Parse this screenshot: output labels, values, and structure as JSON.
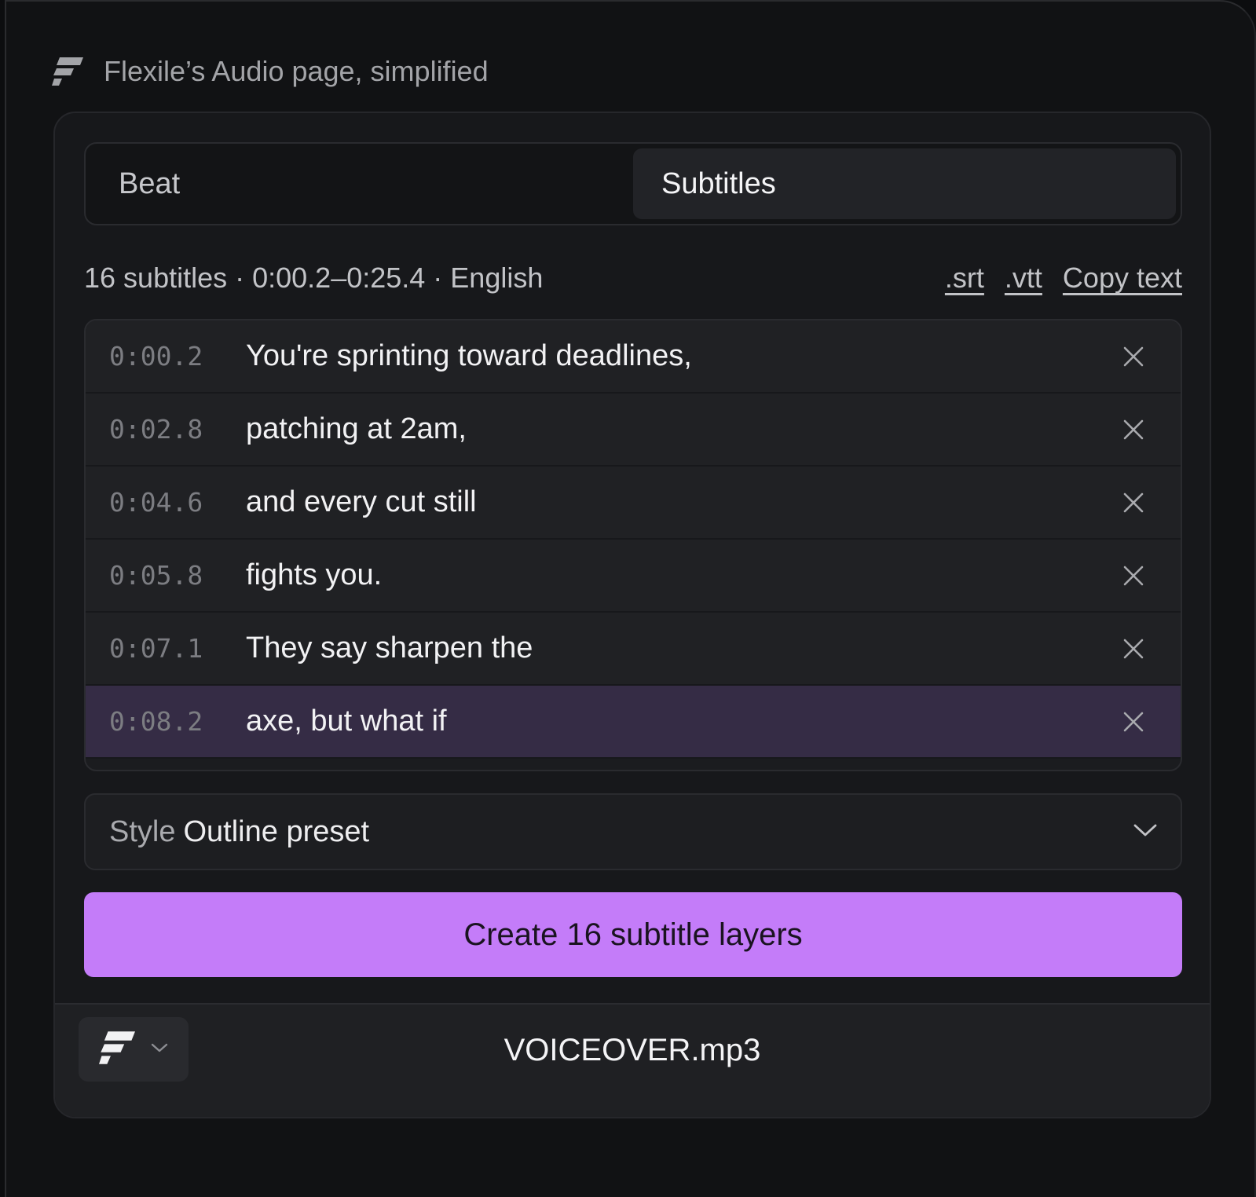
{
  "caption": {
    "title": "Flexile’s Audio page, simplified",
    "logo_icon": "flexile-logo-icon"
  },
  "tabs": [
    {
      "label": "Beat",
      "active": false
    },
    {
      "label": "Subtitles",
      "active": true
    }
  ],
  "summary": {
    "text": "16 subtitles · 0:00.2–0:25.4 · English",
    "links": [
      ".srt",
      ".vtt",
      "Copy text"
    ]
  },
  "subtitles": [
    {
      "time": "0:00.2",
      "text": "You're sprinting toward deadlines,"
    },
    {
      "time": "0:02.8",
      "text": "patching at 2am,"
    },
    {
      "time": "0:04.6",
      "text": "and every cut still"
    },
    {
      "time": "0:05.8",
      "text": "fights you."
    },
    {
      "time": "0:07.1",
      "text": "They say sharpen the"
    },
    {
      "time": "0:08.2",
      "text": "axe, but what if",
      "selected": true
    }
  ],
  "style": {
    "label": "Style",
    "value": "Outline preset"
  },
  "create_button": {
    "label": "Create 16 subtitle layers"
  },
  "footer": {
    "filename": "VOICEOVER.mp3"
  },
  "colors": {
    "accent": "#c47cf9",
    "selected_row": "#352c45",
    "panel": "#17181b"
  }
}
